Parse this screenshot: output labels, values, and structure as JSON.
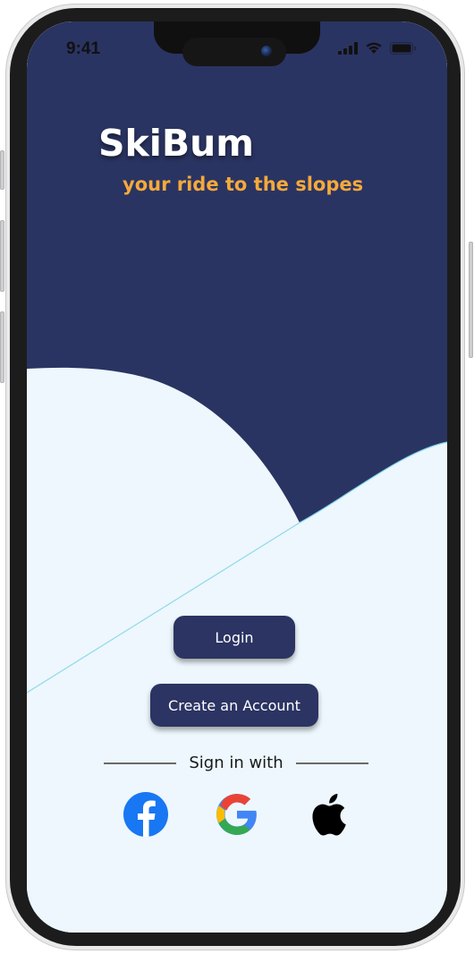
{
  "status_bar": {
    "time": "9:41",
    "icons": [
      "signal-icon",
      "wifi-icon",
      "battery-icon"
    ]
  },
  "app": {
    "title": "SkiBum",
    "tagline": "your ride to the slopes"
  },
  "buttons": {
    "login_label": "Login",
    "create_account_label": "Create an Account"
  },
  "social": {
    "divider_label": "Sign in with",
    "providers": [
      "facebook-icon",
      "google-icon",
      "apple-icon"
    ]
  },
  "colors": {
    "background_dark": "#2a3462",
    "snow": "#edf7fd",
    "button": "#2b3462",
    "tagline": "#f6a93b",
    "title": "#ffffff",
    "facebook": "#1877f2"
  }
}
